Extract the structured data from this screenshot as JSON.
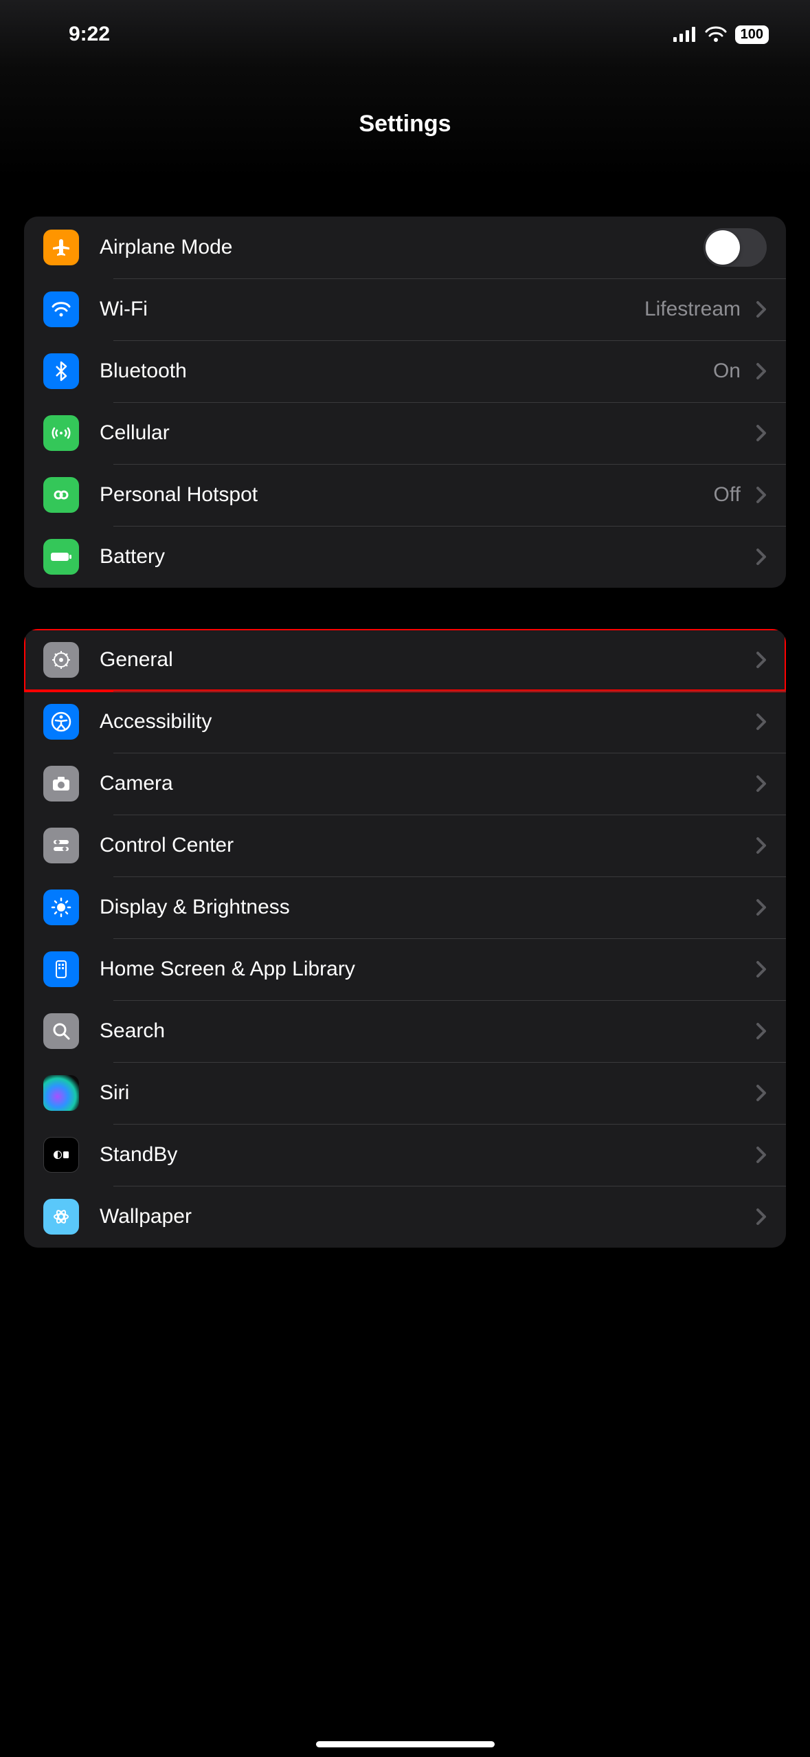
{
  "status": {
    "time": "9:22",
    "battery": "100"
  },
  "header": {
    "title": "Settings"
  },
  "groups": [
    {
      "rows": [
        {
          "key": "airplane",
          "label": "Airplane Mode",
          "icon": "airplane-icon",
          "iconbg": "bg-orange",
          "toggle": true,
          "on": false
        },
        {
          "key": "wifi",
          "label": "Wi-Fi",
          "value": "Lifestream",
          "icon": "wifi-row-icon",
          "iconbg": "bg-blue",
          "chevron": true
        },
        {
          "key": "bluetooth",
          "label": "Bluetooth",
          "value": "On",
          "icon": "bluetooth-icon",
          "iconbg": "bg-blue",
          "chevron": true
        },
        {
          "key": "cellular",
          "label": "Cellular",
          "icon": "cellular-row-icon",
          "iconbg": "bg-green",
          "chevron": true
        },
        {
          "key": "hotspot",
          "label": "Personal Hotspot",
          "value": "Off",
          "icon": "hotspot-icon",
          "iconbg": "bg-green",
          "chevron": true
        },
        {
          "key": "battery",
          "label": "Battery",
          "icon": "battery-row-icon",
          "iconbg": "bg-green",
          "chevron": true
        }
      ]
    },
    {
      "rows": [
        {
          "key": "general",
          "label": "General",
          "icon": "gear-icon",
          "iconbg": "bg-gray",
          "chevron": true,
          "highlight": true
        },
        {
          "key": "accessibility",
          "label": "Accessibility",
          "icon": "accessibility-icon",
          "iconbg": "bg-blue",
          "chevron": true
        },
        {
          "key": "camera",
          "label": "Camera",
          "icon": "camera-icon",
          "iconbg": "bg-gray",
          "chevron": true
        },
        {
          "key": "control-center",
          "label": "Control Center",
          "icon": "control-center-icon",
          "iconbg": "bg-gray",
          "chevron": true
        },
        {
          "key": "display-brightness",
          "label": "Display & Brightness",
          "icon": "brightness-icon",
          "iconbg": "bg-blue",
          "chevron": true
        },
        {
          "key": "home-screen",
          "label": "Home Screen & App Library",
          "icon": "home-grid-icon",
          "iconbg": "bg-blue",
          "chevron": true
        },
        {
          "key": "search",
          "label": "Search",
          "icon": "search-icon",
          "iconbg": "bg-gray",
          "chevron": true
        },
        {
          "key": "siri",
          "label": "Siri",
          "icon": "siri-icon",
          "iconbg": "bg-siri",
          "chevron": true
        },
        {
          "key": "standby",
          "label": "StandBy",
          "icon": "standby-icon",
          "iconbg": "bg-black",
          "chevron": true
        },
        {
          "key": "wallpaper",
          "label": "Wallpaper",
          "icon": "wallpaper-icon",
          "iconbg": "bg-ltblue",
          "chevron": true
        }
      ]
    }
  ]
}
